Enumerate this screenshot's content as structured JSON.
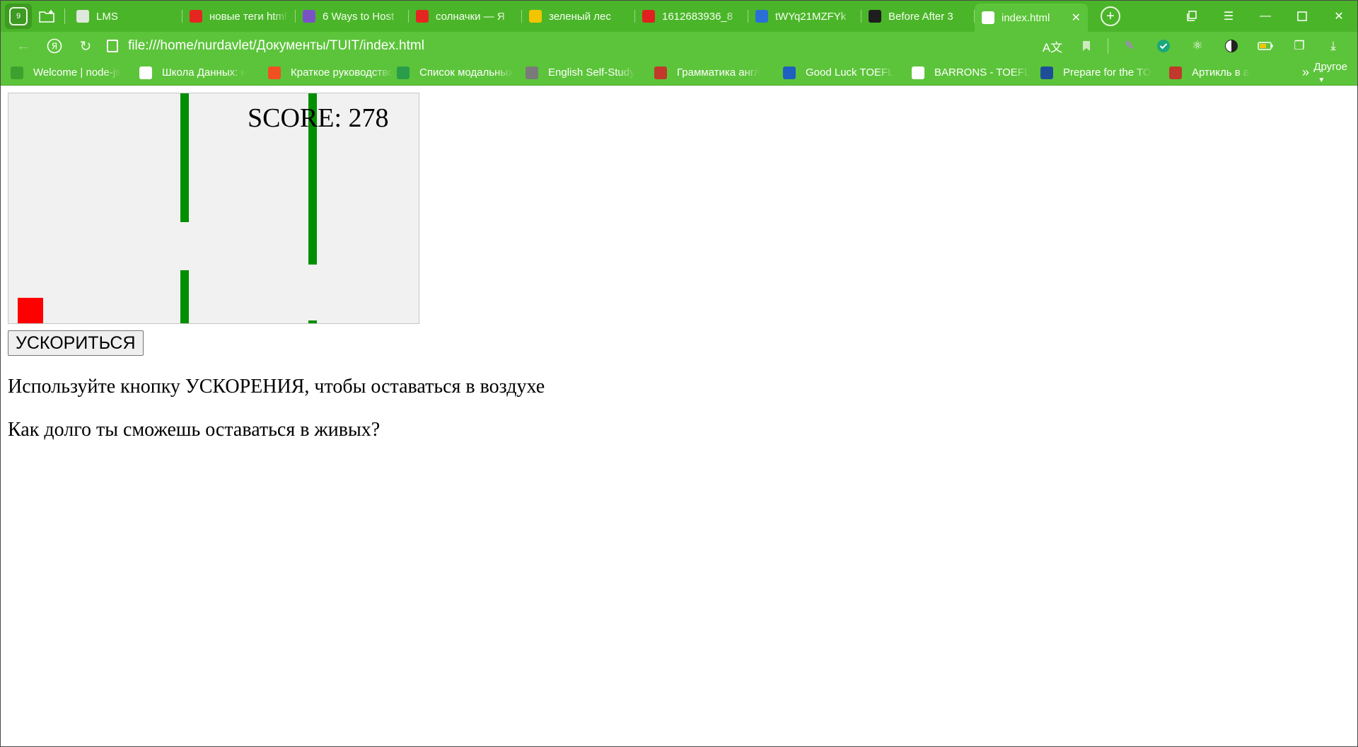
{
  "browser": {
    "tab_count_badge": "9",
    "tabs": [
      {
        "label": "LMS",
        "icon": "lms-icon",
        "color": "#dfe8dc"
      },
      {
        "label": "новые теги html",
        "icon": "yandex-icon",
        "color": "#e52620"
      },
      {
        "label": "6 Ways to Host",
        "icon": "avatar-icon",
        "color": "#7a52c7"
      },
      {
        "label": "солначки — Я",
        "icon": "yandex-icon",
        "color": "#e52620"
      },
      {
        "label": "зеленый лес",
        "icon": "image-icon",
        "color": "#f2c500"
      },
      {
        "label": "1612683936_8",
        "icon": "acrobat-icon",
        "color": "#e02020"
      },
      {
        "label": "tWYq21MZFYk",
        "icon": "vk-icon",
        "color": "#2a6fd6"
      },
      {
        "label": "Before After 3",
        "icon": "codepen-icon",
        "color": "#1e1e1e"
      },
      {
        "label": "index.html",
        "icon": "file-icon",
        "color": "#ffffff",
        "active": true
      }
    ],
    "url": "file:///home/nurdavlet/Документы/TUIT/index.html",
    "bookmarks": [
      {
        "label": "Welcome | node-js",
        "icon": "node-icon",
        "color": "#3da12f"
      },
      {
        "label": "Школа Данных: к",
        "icon": "snowflake-icon",
        "color": "#ffffff"
      },
      {
        "label": "Краткое руководство",
        "icon": "microsoft-icon",
        "color": "#f25022"
      },
      {
        "label": "Список модальных",
        "icon": "a-icon",
        "color": "#2a9d4a"
      },
      {
        "label": "English Self-Study",
        "icon": "grad-cap-icon",
        "color": "#7a7a7a"
      },
      {
        "label": "Грамматика англ",
        "icon": "book-icon",
        "color": "#c0392b"
      },
      {
        "label": "Good Luck TOEFL",
        "icon": "checkbox-icon",
        "color": "#1f5fbf"
      },
      {
        "label": "BARRONS - TOEFL",
        "icon": "doc-icon",
        "color": "#ffffff"
      },
      {
        "label": "Prepare for the TO",
        "icon": "ets-icon",
        "color": "#1f4e99"
      },
      {
        "label": "Артикль в а",
        "icon": "book-icon",
        "color": "#c0392b"
      }
    ],
    "bookmarks_other": "Другое"
  },
  "game": {
    "score_text": "SCORE: 278",
    "player_color": "#ff0000",
    "pipe_color": "#008f00",
    "background": "#f1f1f1"
  },
  "page": {
    "boost_button": "УСКОРИТЬСЯ",
    "line1": "Используйте кнопку УСКОРЕНИЯ, чтобы оставаться в воздухе",
    "line2": "Как долго ты сможешь оставаться в живых?"
  }
}
